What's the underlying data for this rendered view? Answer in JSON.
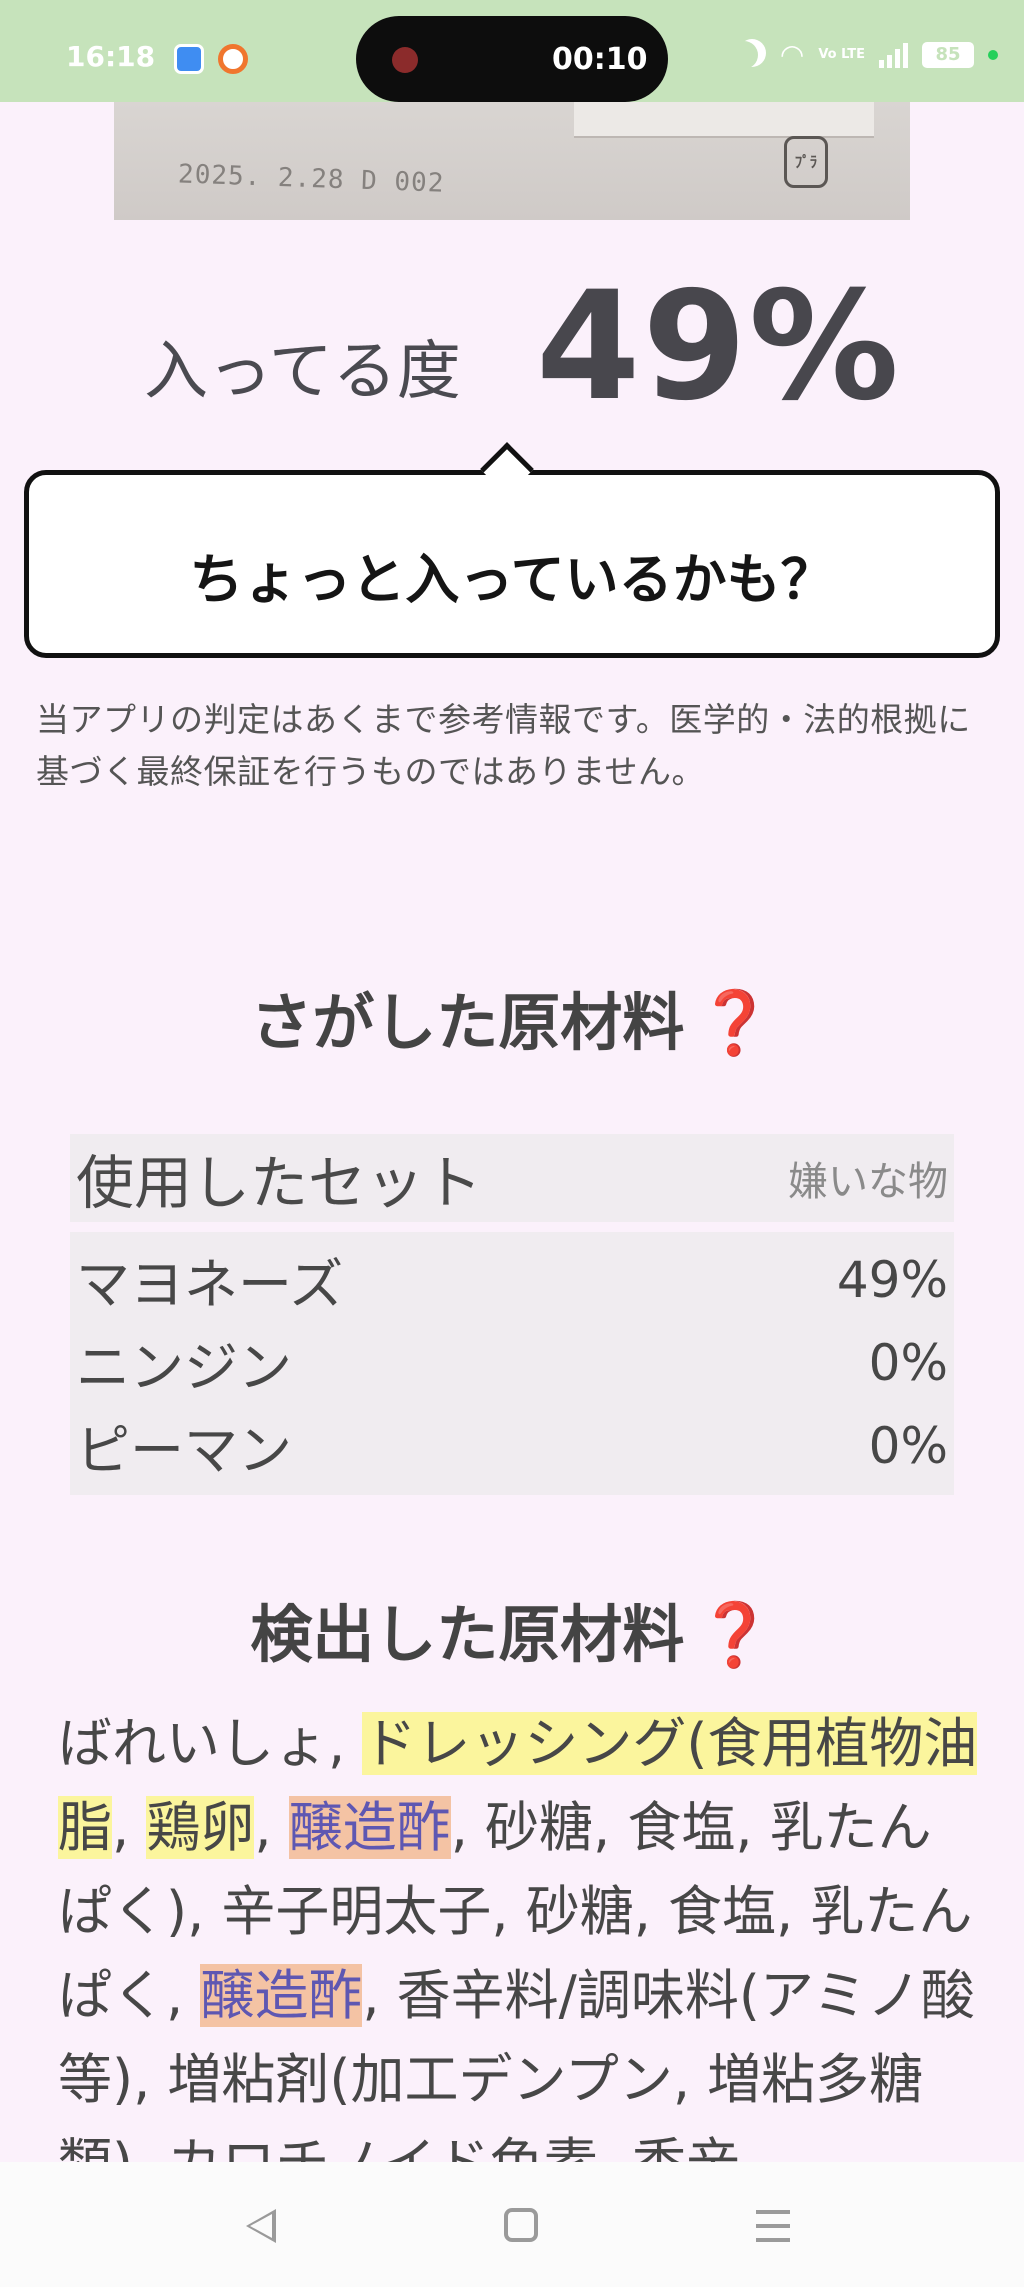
{
  "status_bar": {
    "time": "16:18",
    "recording_time": "00:10",
    "battery": "85",
    "network": "Vo LTE"
  },
  "photo": {
    "printed_text": "2025. 2.28  D 002",
    "recycle_mark": "ﾌﾟﾗ"
  },
  "score": {
    "label": "入ってる度",
    "value": "49%"
  },
  "verdict": "ちょっと入っているかも？",
  "disclaimer": "当アプリの判定はあくまで参考情報です。医学的・法的根拠に基づく最終保証を行うものではありません。",
  "searched": {
    "title": "さがした原材料",
    "help_icon": "❓",
    "set_label": "使用したセット",
    "set_name": "嫌いな物",
    "rows": [
      {
        "name": "マヨネーズ",
        "percent": "49%"
      },
      {
        "name": "ニンジン",
        "percent": "0%"
      },
      {
        "name": "ピーマン",
        "percent": "0%"
      }
    ]
  },
  "detected": {
    "title": "検出した原材料",
    "help_icon": "❓",
    "segments": [
      {
        "text": "ばれいしょ, ",
        "hl": ""
      },
      {
        "text": "ドレッシング(食用植物油脂",
        "hl": "yellow"
      },
      {
        "text": ", ",
        "hl": ""
      },
      {
        "text": "鶏卵",
        "hl": "yellow"
      },
      {
        "text": ", ",
        "hl": ""
      },
      {
        "text": "醸造酢",
        "hl": "orange"
      },
      {
        "text": ", 砂糖, 食塩, 乳たんぱく), 辛子明太子, 砂糖, 食塩, 乳たんぱく, ",
        "hl": ""
      },
      {
        "text": "醸造酢",
        "hl": "orange"
      },
      {
        "text": ", 香辛料/調味料(アミノ酸等), 増粘剤(加工デンプン, 増粘多糖類), カロチノイド色素, 香辛",
        "hl": ""
      }
    ]
  },
  "nav": {
    "back_icon": "back-triangle",
    "home_icon": "home-square",
    "menu_icon": "menu-lines"
  }
}
